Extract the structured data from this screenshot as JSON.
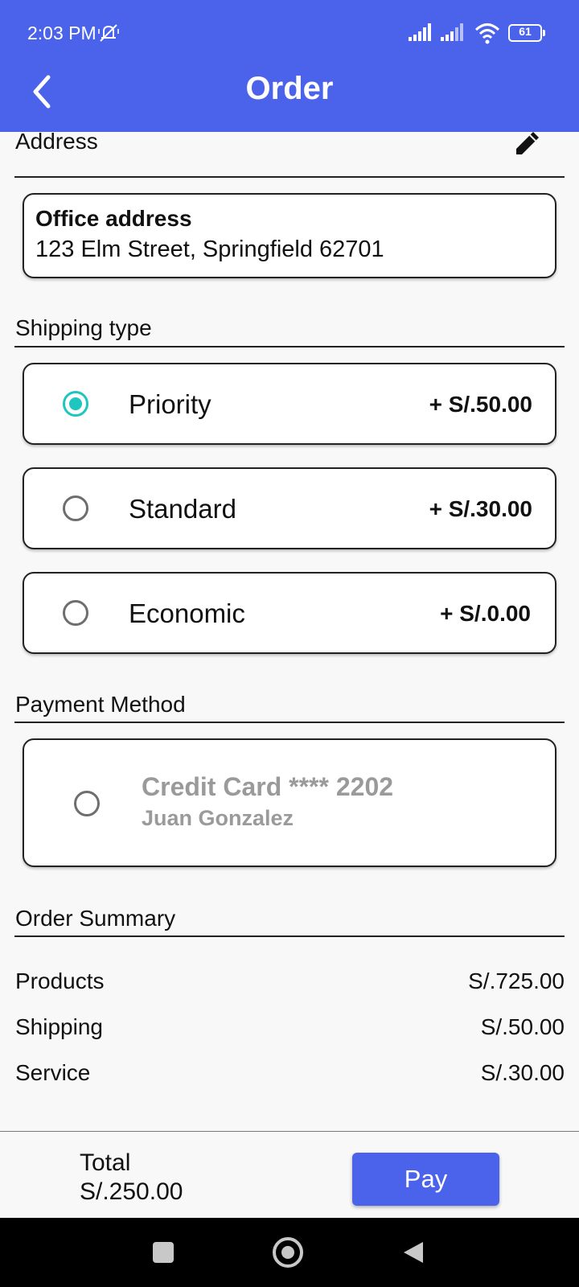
{
  "status_bar": {
    "time": "2:03 PM",
    "battery_level": "61"
  },
  "appbar": {
    "title": "Order",
    "back_icon": "chevron-left-icon"
  },
  "address": {
    "section_title": "Address",
    "edit_icon": "pencil-icon",
    "card_title": "Office address",
    "card_line": "123 Elm Street, Springfield 62701"
  },
  "shipping": {
    "section_title": "Shipping type",
    "options": [
      {
        "label": "Priority",
        "price": "+ S/.50.00",
        "selected": true
      },
      {
        "label": "Standard",
        "price": "+ S/.30.00",
        "selected": false
      },
      {
        "label": "Economic",
        "price": "+ S/.0.00",
        "selected": false
      }
    ]
  },
  "payment": {
    "section_title": "Payment Method",
    "card_title": "Credit Card **** 2202",
    "card_holder": "Juan Gonzalez"
  },
  "summary": {
    "section_title": "Order Summary",
    "rows": [
      {
        "label": "Products",
        "value": "S/.725.00"
      },
      {
        "label": "Shipping",
        "value": "S/.50.00"
      },
      {
        "label": "Service",
        "value": "S/.30.00"
      }
    ]
  },
  "footer": {
    "total_label": "Total",
    "total_value": "S/.250.00",
    "pay_label": "Pay"
  },
  "colors": {
    "primary": "#4a63ea",
    "radio_selected": "#1fc6c0"
  }
}
